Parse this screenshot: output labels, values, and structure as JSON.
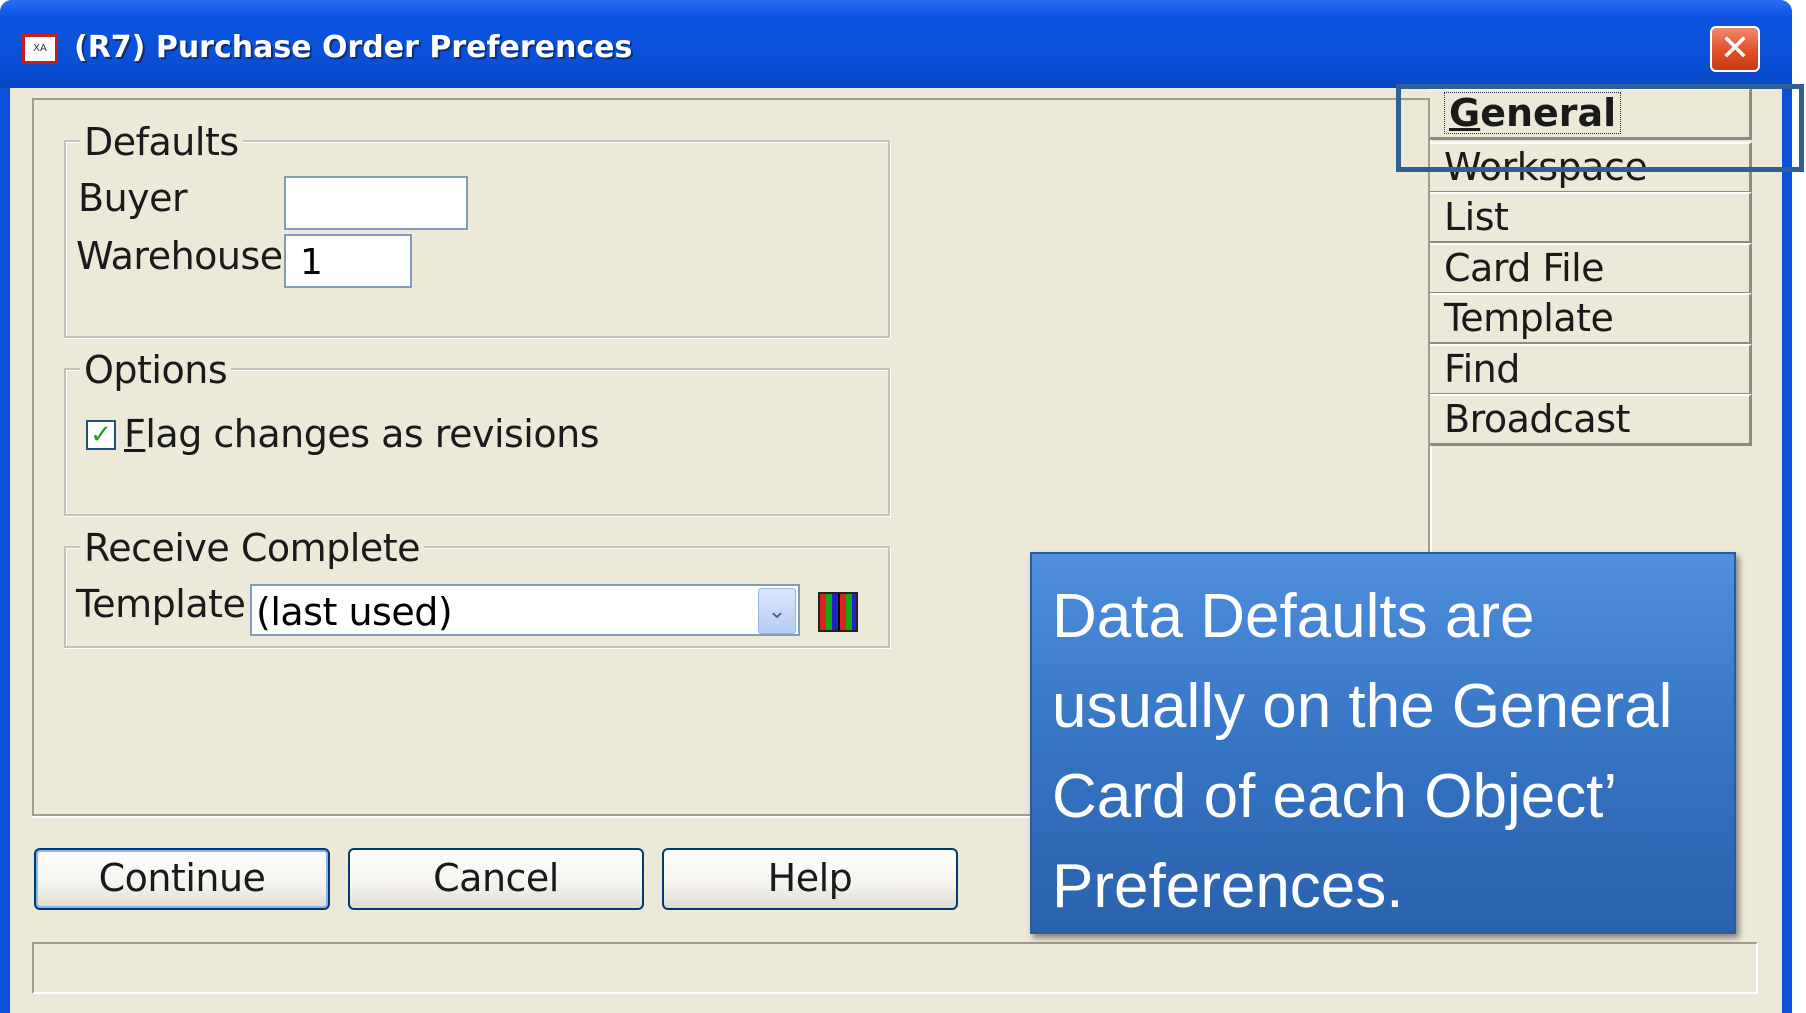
{
  "window": {
    "title": "(R7) Purchase Order Preferences",
    "icon": "app-icon",
    "close_symbol": "✕"
  },
  "defaults": {
    "legend": "Defaults",
    "buyer_label": "Buyer",
    "buyer_value": "",
    "warehouse_label": "Warehouse",
    "warehouse_value": "1"
  },
  "options": {
    "legend": "Options",
    "flag_changes": {
      "label_first": "F",
      "label_rest": "lag changes as revisions",
      "checked": true
    }
  },
  "receive_complete": {
    "legend": "Receive Complete",
    "template_label": "Template",
    "template_value": "(last used)"
  },
  "buttons": {
    "continue": "Continue",
    "cancel": "Cancel",
    "help": "Help"
  },
  "tabs": [
    {
      "first": "G",
      "rest": "eneral",
      "active": true
    },
    {
      "label": "Workspace"
    },
    {
      "label": "List"
    },
    {
      "label": "Card File"
    },
    {
      "label": "Template"
    },
    {
      "label": "Find"
    },
    {
      "label": "Broadcast"
    }
  ],
  "callout": {
    "text": "Data Defaults are usually on the General Card of each Object’ Preferences."
  },
  "colors": {
    "titlebar": "#0a4fd6",
    "client": "#ece9d8",
    "callout": "#3674c4",
    "highlight": "#2f5f97"
  }
}
